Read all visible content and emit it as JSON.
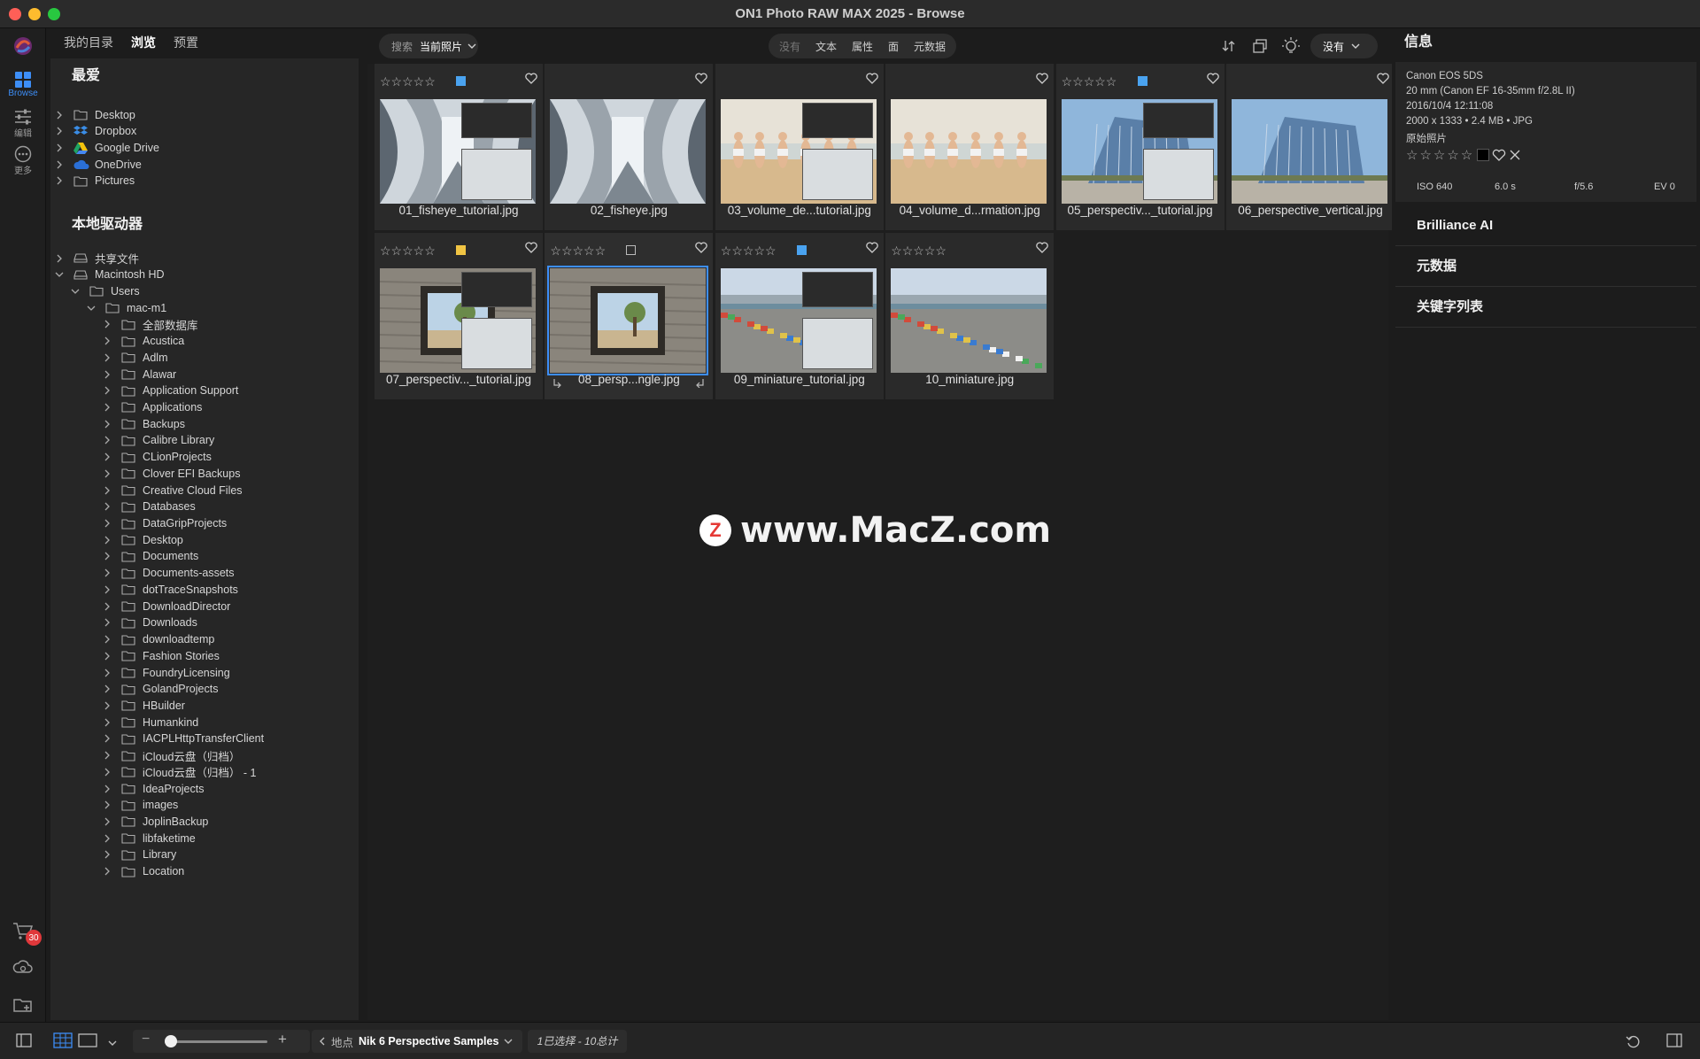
{
  "window": {
    "title": "ON1 Photo RAW MAX 2025 - Browse"
  },
  "rail": {
    "browse_label": "Browse",
    "edit_label": "编辑",
    "more_label": "更多",
    "cart_count": "30"
  },
  "left_tabs": [
    "我的目录",
    "浏览",
    "预置"
  ],
  "favorites": {
    "heading": "最爱",
    "items": [
      "Desktop",
      "Dropbox",
      "Google Drive",
      "OneDrive",
      "Pictures"
    ]
  },
  "local": {
    "heading": "本地驱动器",
    "shared": "共享文件",
    "drive": "Macintosh HD",
    "users": "Users",
    "home": "mac-m1",
    "folders": [
      "全部数据库",
      "Acustica",
      "Adlm",
      "Alawar",
      "Application Support",
      "Applications",
      "Backups",
      "Calibre Library",
      "CLionProjects",
      "Clover EFI Backups",
      "Creative Cloud Files",
      "Databases",
      "DataGripProjects",
      "Desktop",
      "Documents",
      "Documents-assets",
      "dotTraceSnapshots",
      "DownloadDirector",
      "Downloads",
      "downloadtemp",
      "Fashion Stories",
      "FoundryLicensing",
      "GolandProjects",
      "HBuilder",
      "Humankind",
      "IACPLHttpTransferClient",
      "iCloud云盘（归档）",
      "iCloud云盘（归档） - 1",
      "IdeaProjects",
      "images",
      "JoplinBackup",
      "libfaketime",
      "Library",
      "Location"
    ]
  },
  "toolbar": {
    "search_label": "搜索",
    "search_scope": "当前照片",
    "filters": [
      "没有",
      "文本",
      "属性",
      "面",
      "元数据"
    ],
    "sort_value": "没有"
  },
  "photos": [
    {
      "name": "01_fisheye_tutorial.jpg",
      "label_color": "#4aa3f0"
    },
    {
      "name": "02_fisheye.jpg",
      "label_color": ""
    },
    {
      "name": "03_volume_de...tutorial.jpg",
      "label_color": ""
    },
    {
      "name": "04_volume_d...rmation.jpg",
      "label_color": ""
    },
    {
      "name": "05_perspectiv..._tutorial.jpg",
      "label_color": "#4aa3f0"
    },
    {
      "name": "06_perspective_vertical.jpg",
      "label_color": ""
    },
    {
      "name": "07_perspectiv..._tutorial.jpg",
      "label_color": "#f0c443"
    },
    {
      "name": "08_persp...ngle.jpg",
      "label_color": ""
    },
    {
      "name": "09_miniature_tutorial.jpg",
      "label_color": "#4aa3f0"
    },
    {
      "name": "10_miniature.jpg",
      "label_color": ""
    }
  ],
  "info": {
    "tab": "信息",
    "camera": "Canon EOS 5DS",
    "lens": "20 mm (Canon EF 16-35mm f/2.8L II)",
    "datetime": "2016/10/4  12:11:08",
    "dims": "2000 x 1333 • 2.4 MB • JPG",
    "original": "原始照片",
    "iso": "ISO 640",
    "shutter": "6.0 s",
    "aperture": "f/5.6",
    "ev": "EV 0"
  },
  "sections": [
    "Brilliance AI",
    "元数据",
    "关键字列表"
  ],
  "statusbar": {
    "location_prefix": "地点",
    "location": "Nik 6 Perspective Samples",
    "selection": "1已选择 - 10总计"
  },
  "watermark": "www.MacZ.com"
}
